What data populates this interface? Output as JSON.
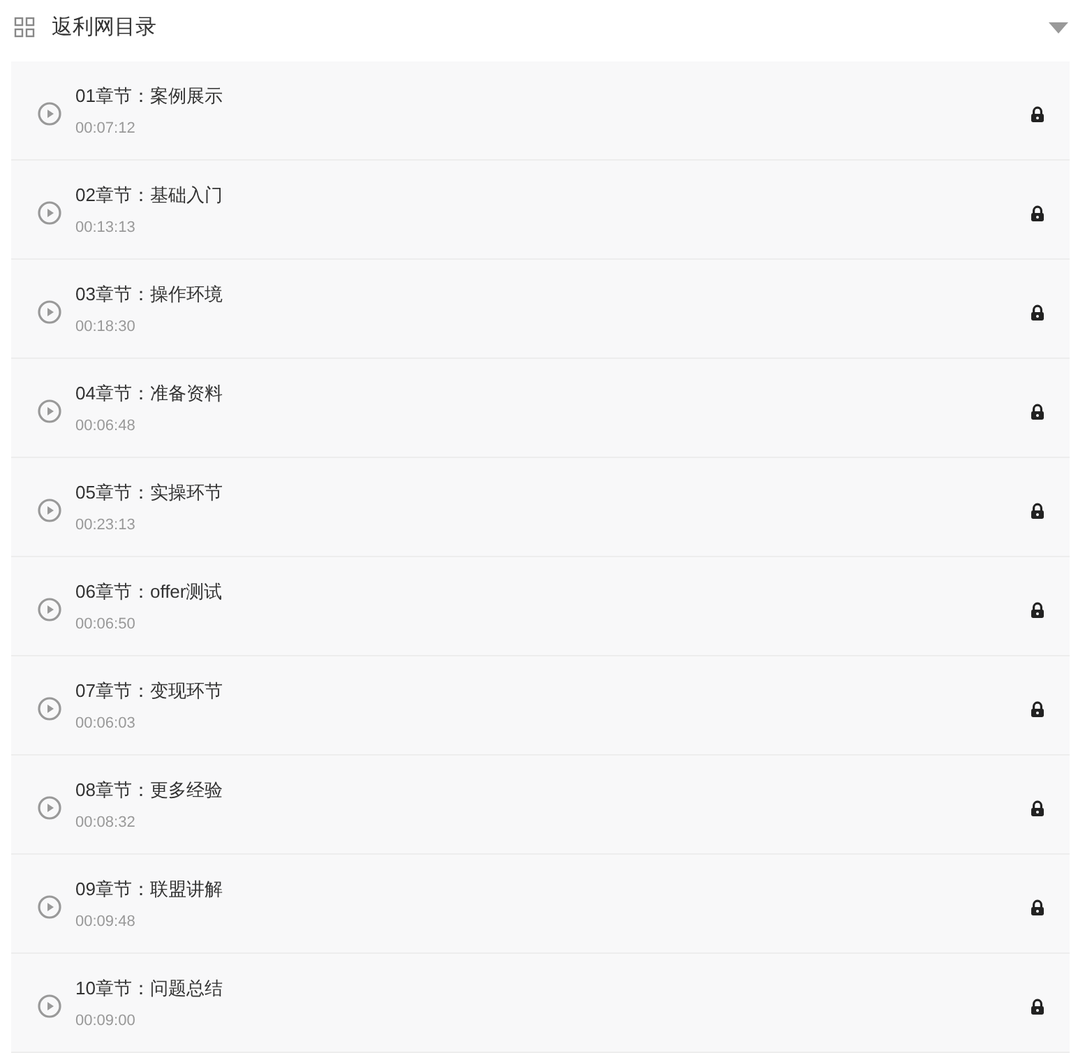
{
  "catalog": {
    "title": "返利网目录",
    "expanded": true
  },
  "lessons": [
    {
      "title": "01章节：案例展示",
      "duration": "00:07:12",
      "locked": true
    },
    {
      "title": "02章节：基础入门",
      "duration": "00:13:13",
      "locked": true
    },
    {
      "title": "03章节：操作环境",
      "duration": "00:18:30",
      "locked": true
    },
    {
      "title": "04章节：准备资料",
      "duration": "00:06:48",
      "locked": true
    },
    {
      "title": "05章节：实操环节",
      "duration": "00:23:13",
      "locked": true
    },
    {
      "title": "06章节：offer测试",
      "duration": "00:06:50",
      "locked": true
    },
    {
      "title": "07章节：变现环节",
      "duration": "00:06:03",
      "locked": true
    },
    {
      "title": "08章节：更多经验",
      "duration": "00:08:32",
      "locked": true
    },
    {
      "title": "09章节：联盟讲解",
      "duration": "00:09:48",
      "locked": true
    },
    {
      "title": "10章节：问题总结",
      "duration": "00:09:00",
      "locked": true
    }
  ]
}
